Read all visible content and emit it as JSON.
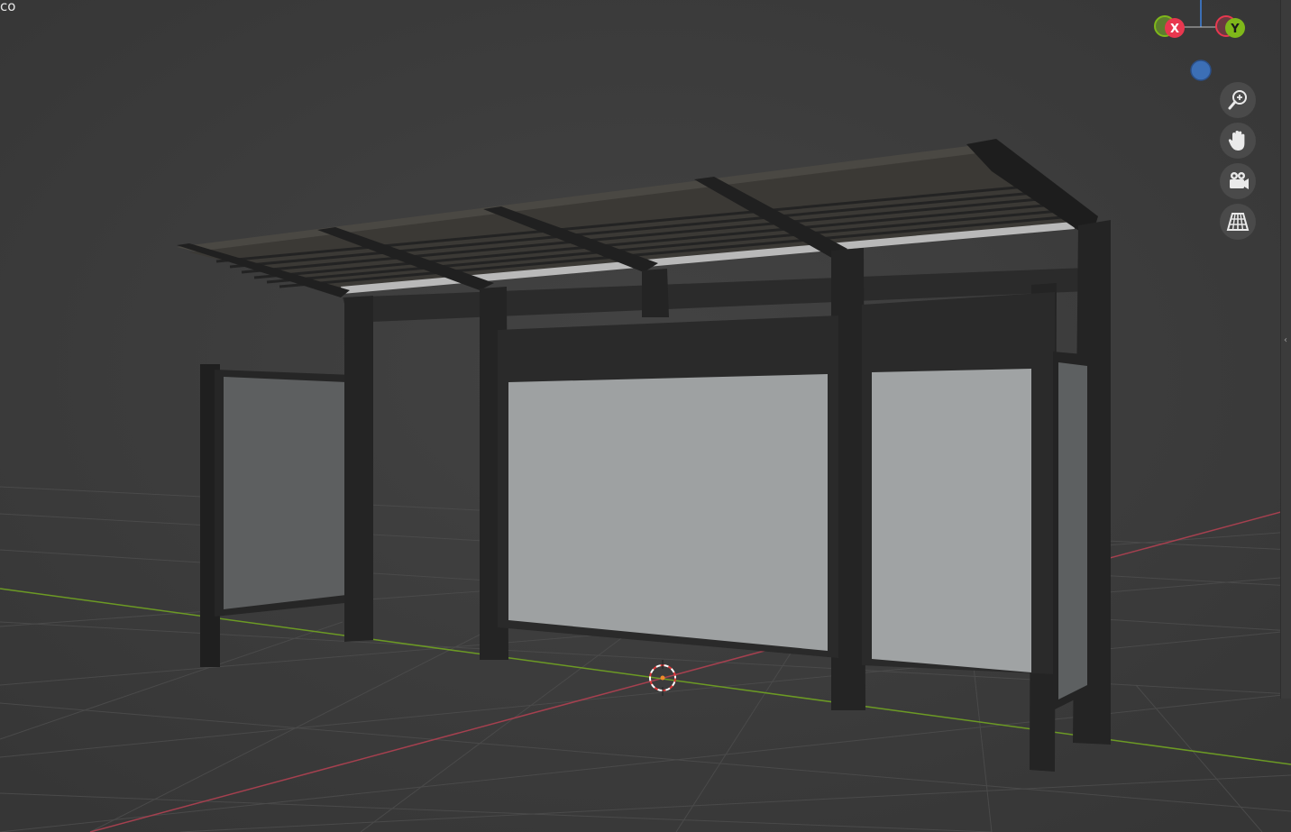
{
  "viewport": {
    "corner_text": "co",
    "background_color": "#3d3d3d"
  },
  "gizmo": {
    "x_label": "X",
    "y_label": "Y",
    "x_color": "#e8374f",
    "y_color": "#7fb81a",
    "z_color": "#3c6fb6"
  },
  "navigation": {
    "zoom_icon": "zoom-in-icon",
    "pan_icon": "hand-icon",
    "camera_icon": "camera-icon",
    "ortho_icon": "grid-perspective-icon"
  },
  "scene": {
    "object": "bus-shelter",
    "frame_color": "#2a2a2a",
    "panel_color": "#9fa2a3",
    "grid_x_axis_color": "#b04656",
    "grid_y_axis_color": "#6f9a2a"
  }
}
